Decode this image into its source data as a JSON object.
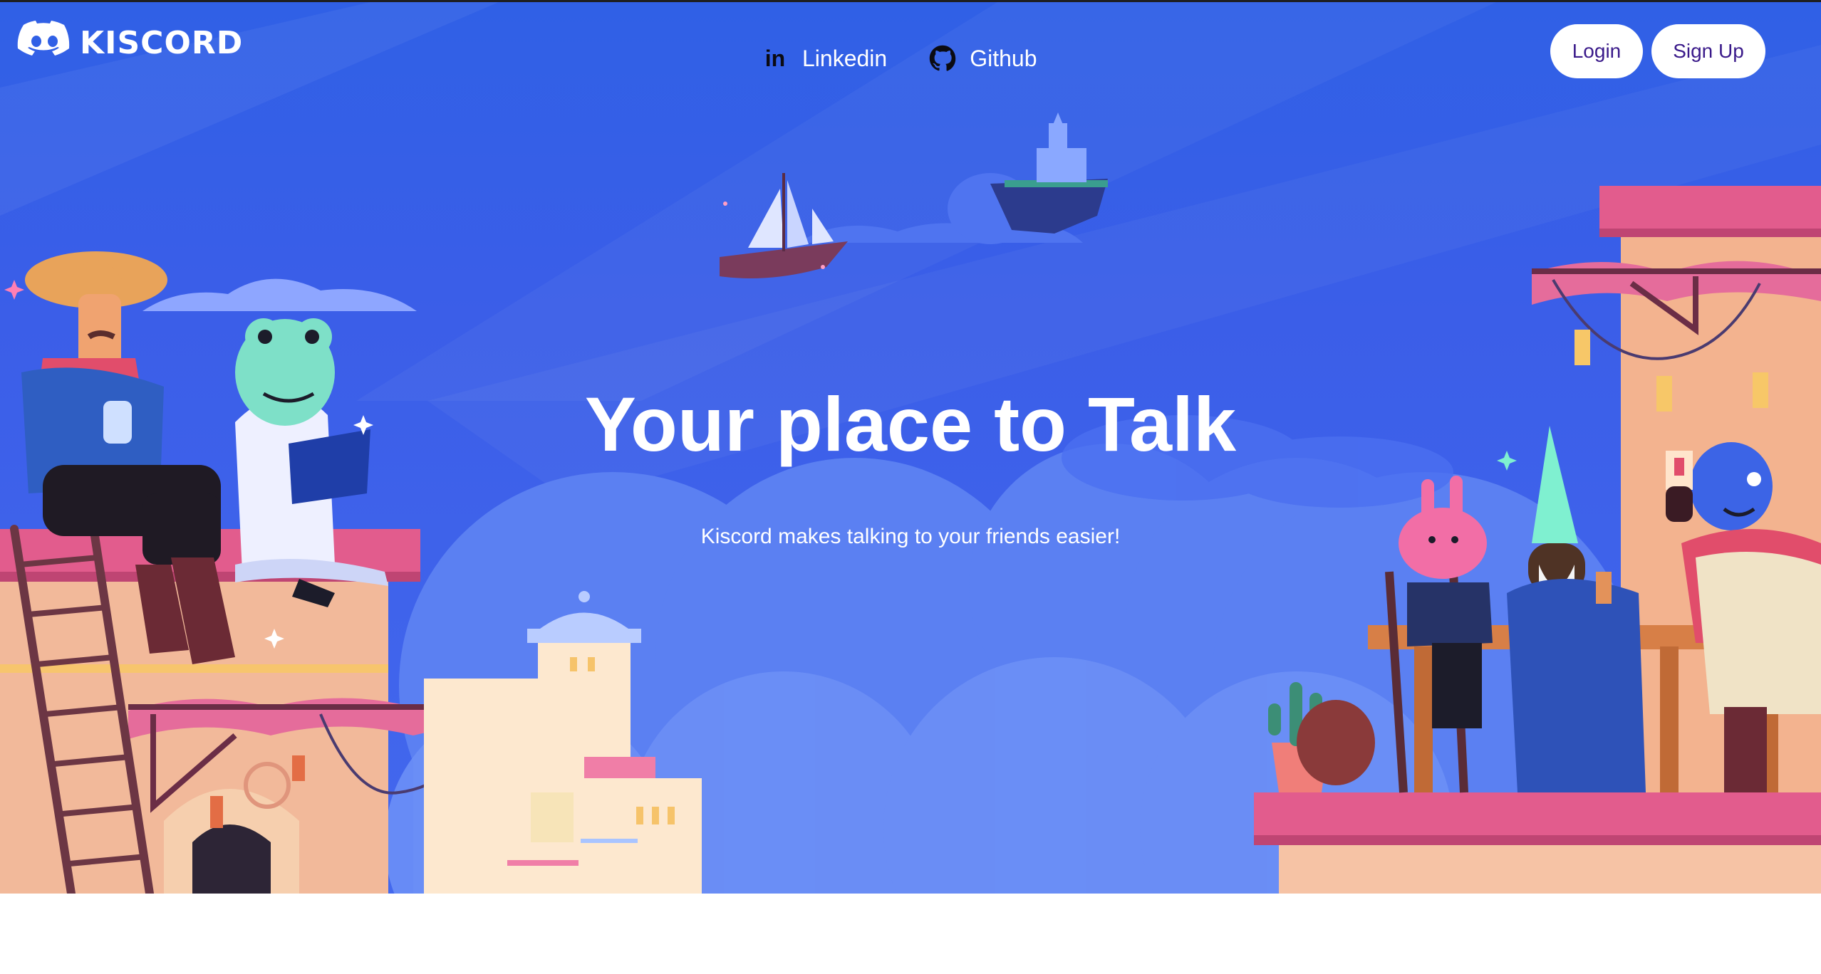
{
  "brand": {
    "name": "KISCORD",
    "logo_icon": "discord-controller-icon"
  },
  "nav": {
    "links": [
      {
        "label": "Linkedin",
        "icon": "linkedin-icon"
      },
      {
        "label": "Github",
        "icon": "github-icon"
      }
    ]
  },
  "auth": {
    "login_label": "Login",
    "signup_label": "Sign Up"
  },
  "hero": {
    "title": "Your place to Talk",
    "subtitle": "Kiscord makes talking to your friends easier!"
  },
  "colors": {
    "hero_bg": "#3b5ee8",
    "cloud": "#5f86f4",
    "button_text": "#3a1a8a",
    "accent_pink": "#e0628f"
  }
}
